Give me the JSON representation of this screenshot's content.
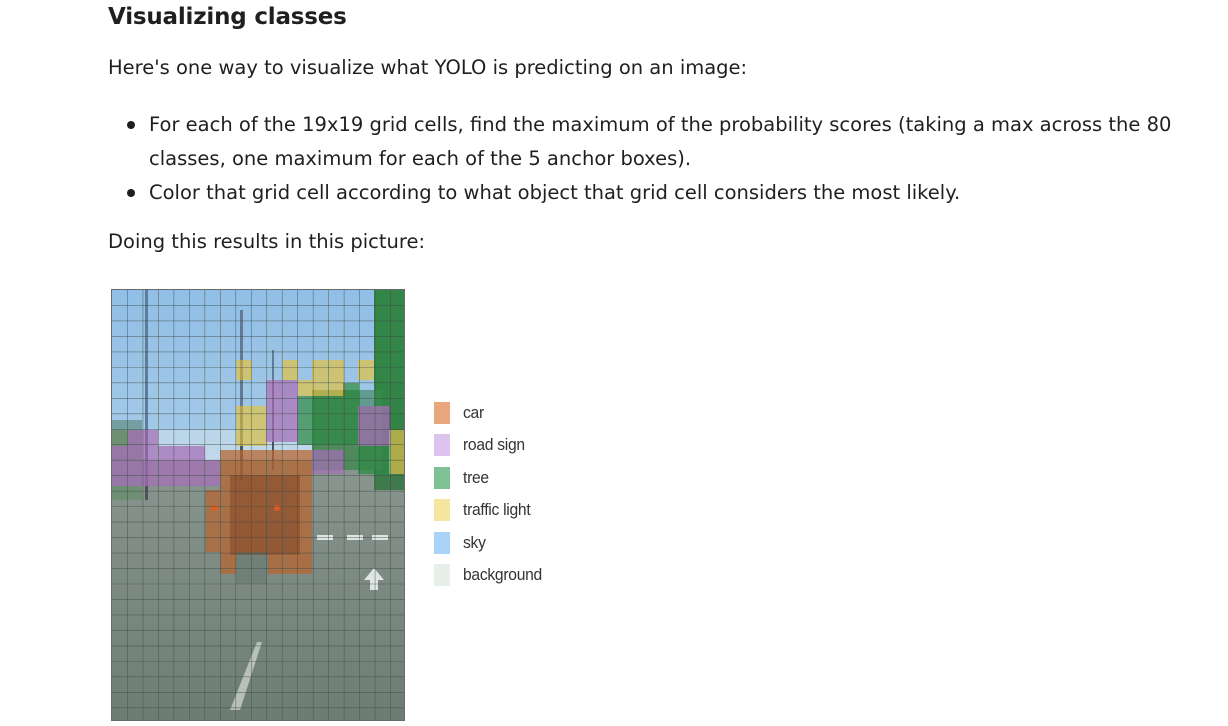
{
  "heading": "Visualizing classes",
  "intro": "Here's one way to visualize what YOLO is predicting on an image:",
  "bullets": [
    "For each of the 19x19 grid cells, find the maximum of the probability scores (taking a max across the 80 classes, one maximum for each of the 5 anchor boxes).",
    "Color that grid cell according to what object that grid cell considers the most likely."
  ],
  "doing": "Doing this results in this picture:",
  "figure": {
    "grid_cells": 19,
    "legend": [
      {
        "label": "car",
        "color": "#e8a67e"
      },
      {
        "label": "road sign",
        "color": "#dcc4ef"
      },
      {
        "label": "tree",
        "color": "#7fc195"
      },
      {
        "label": "traffic light",
        "color": "#f6e59e"
      },
      {
        "label": "sky",
        "color": "#a9d3f7"
      },
      {
        "label": "background",
        "color": "#e6efe9"
      }
    ],
    "overlay_colors": {
      "car": "#b8652e",
      "road_sign": "#a66fb8",
      "tree": "#2e8a45",
      "traffic_light": "#d8bf4a",
      "sky": "#7fb6e6",
      "background": "#7c8c84"
    }
  }
}
